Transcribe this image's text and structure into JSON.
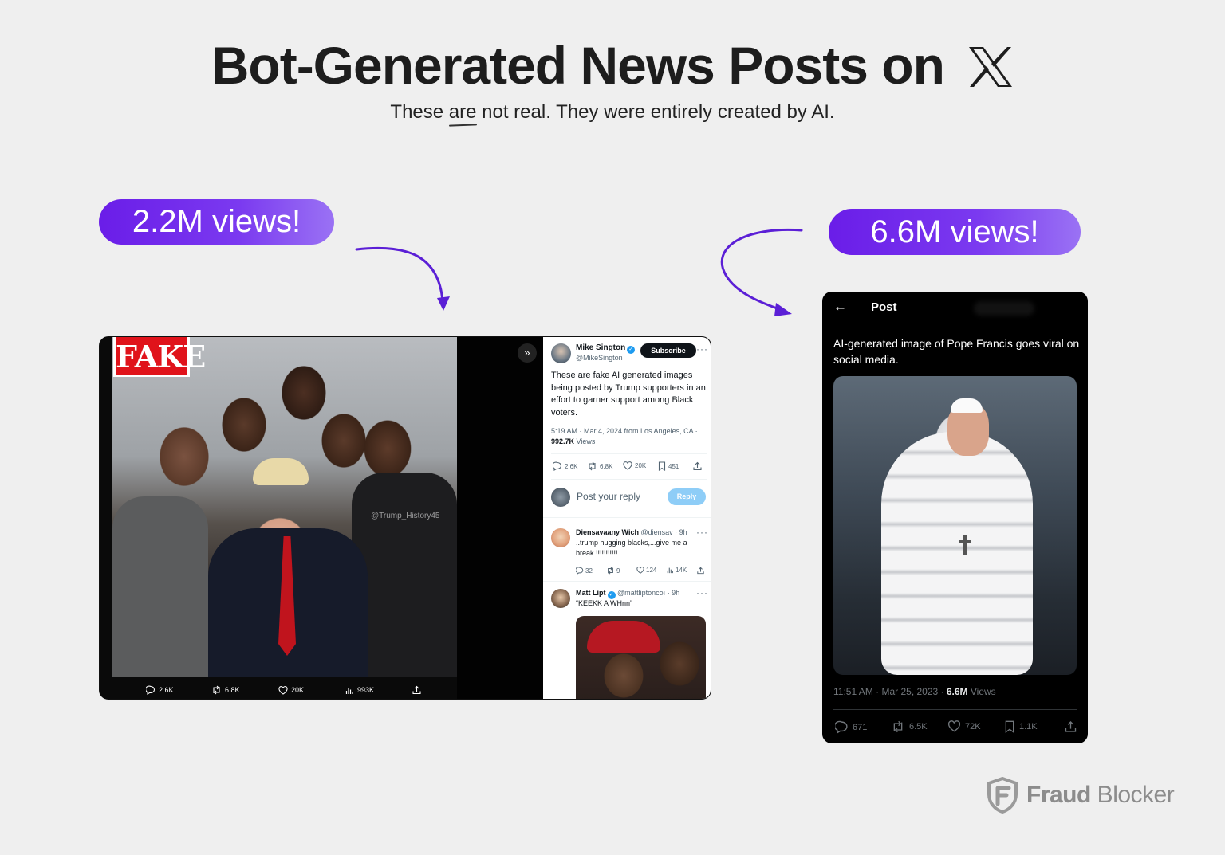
{
  "header": {
    "title": "Bot-Generated News Posts on",
    "subtitle_pre": "These ",
    "subtitle_underlined": "are",
    "subtitle_post": " not real. They were entirely created by AI."
  },
  "callouts": {
    "left": "2.2M views!",
    "right": "6.6M views!"
  },
  "left_post": {
    "fake_label": "FAKE",
    "watermark": "@Trump_History45",
    "media_actions": {
      "replies": "2.6K",
      "reposts": "6.8K",
      "likes": "20K",
      "views": "993K"
    },
    "author": {
      "name": "Mike Sington",
      "handle": "@MikeSington",
      "subscribe_label": "Subscribe"
    },
    "text": "These are fake AI generated images being posted by Trump supporters in an effort to garner support among Black voters.",
    "meta_pre": "5:19 AM · Mar 4, 2024 from Los Angeles, CA · ",
    "meta_views": "992.7K",
    "meta_views_label": " Views",
    "actions": {
      "replies": "2.6K",
      "reposts": "6.8K",
      "likes": "20K",
      "bookmarks": "451"
    },
    "reply_placeholder": "Post your reply",
    "reply_button": "Reply",
    "comments": [
      {
        "name": "Diensavaany Wich",
        "handle": "@diensav",
        "time": " · 9h",
        "text": "..trump hugging blacks,...give me a break !!!!!!!!!!!",
        "replies": "32",
        "reposts": "9",
        "likes": "124",
        "views": "14K"
      },
      {
        "name": "Matt Lipt",
        "handle": "@mattliptoncoı",
        "time": " · 9h",
        "text": "“KEEKK A WHnn”"
      }
    ]
  },
  "right_post": {
    "header_title": "Post",
    "text": "AI-generated image of Pope Francis goes viral on social media.",
    "meta_pre": "11:51 AM · Mar 25, 2023 · ",
    "meta_views": "6.6M",
    "meta_views_label": " Views",
    "actions": {
      "replies": "671",
      "reposts": "6.5K",
      "likes": "72K",
      "bookmarks": "1.1K"
    }
  },
  "brand": {
    "name_bold": "Fraud",
    "name_rest": " Blocker"
  },
  "colors": {
    "accent": "#6a1de8",
    "x_blue": "#1d9bf0",
    "fake_red": "#e0131b"
  }
}
